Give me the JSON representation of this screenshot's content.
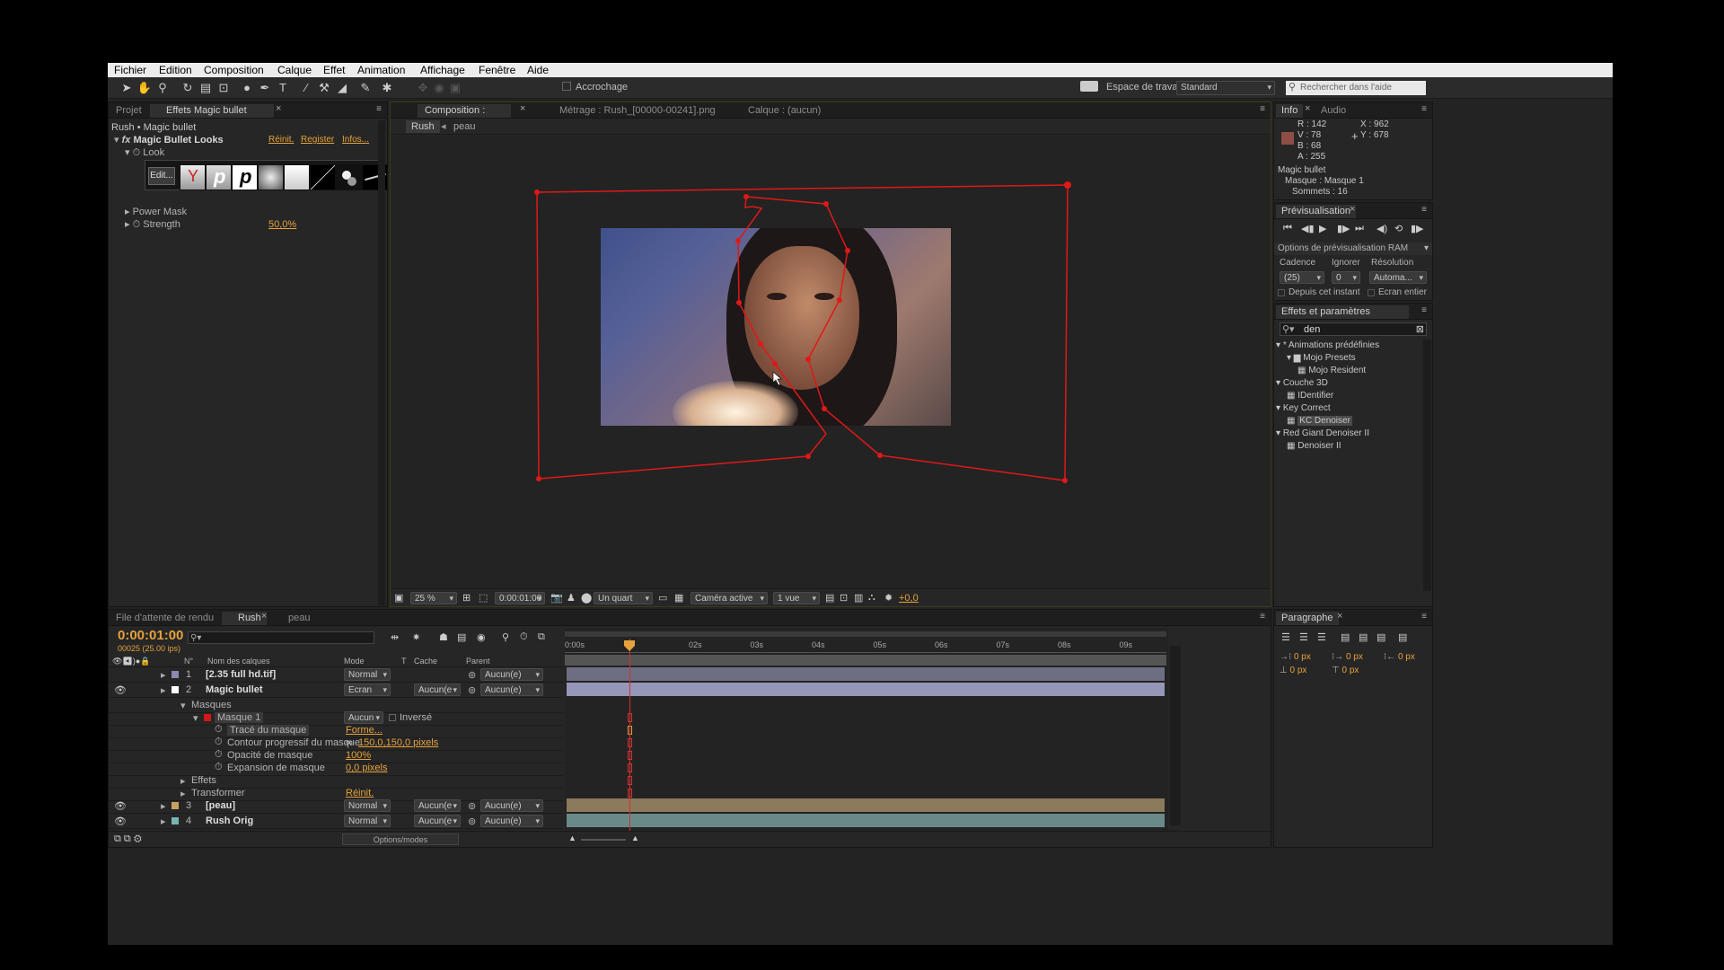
{
  "menu": [
    "Fichier",
    "Edition",
    "Composition",
    "Calque",
    "Effet",
    "Animation",
    "Affichage",
    "Fenêtre",
    "Aide"
  ],
  "toolbar": {
    "snapping": "Accrochage",
    "workspace_label": "Espace de travail :",
    "workspace_value": "Standard",
    "search_placeholder": "Rechercher dans l'aide"
  },
  "left_panel": {
    "tab_project": "Projet",
    "tab_effects": "Effets Magic bullet",
    "breadcrumb": "Rush • Magic bullet",
    "fx_name": "Magic Bullet Looks",
    "reset": "Réinit.",
    "register": "Register",
    "infos": "Infos...",
    "look_label": "Look",
    "edit_button": "Edit...",
    "power_mask": "Power Mask",
    "strength_label": "Strength",
    "strength_value": "50,0%"
  },
  "viewer": {
    "tab_comp": "Composition : Rush",
    "tab_footage": "Métrage : Rush_[00000-00241].png",
    "tab_layer": "Calque : (aucun)",
    "flow_rush": "Rush",
    "flow_peau": "peau",
    "zoom": "25 %",
    "timecode": "0:00:01:00",
    "resolution": "Un quart",
    "camera": "Caméra active",
    "views": "1 vue",
    "exposure": "+0,0"
  },
  "info_panel": {
    "tab_info": "Info",
    "tab_audio": "Audio",
    "r": "R : 142",
    "v": "V : 78",
    "b": "B : 68",
    "a": "A : 255",
    "x": "X : 962",
    "y": "Y : 678",
    "layer": "Magic bullet",
    "mask": "Masque : Masque 1",
    "vertices": "Sommets : 16",
    "swatch": "#8e4e44"
  },
  "preview_panel": {
    "tab": "Prévisualisation",
    "ram_options": "Options de prévisualisation RAM",
    "framerate_label": "Cadence",
    "skip_label": "Ignorer",
    "resolution_label": "Résolution",
    "framerate_value": "(25)",
    "skip_value": "0",
    "resolution_value": "Automa...",
    "from_current": "Depuis cet instant",
    "fullscreen": "Ecran entier"
  },
  "effects_panel": {
    "tab": "Effets et paramètres prédéfinis",
    "search_value": "den",
    "tree": [
      {
        "label": "* Animations prédéfinies",
        "level": 0,
        "type": "folder-open"
      },
      {
        "label": "Mojo Presets",
        "level": 1,
        "type": "folder"
      },
      {
        "label": "Mojo Resident",
        "level": 2,
        "type": "preset"
      },
      {
        "label": "Couche 3D",
        "level": 0,
        "type": "folder-open"
      },
      {
        "label": "IDentifier",
        "level": 1,
        "type": "effect"
      },
      {
        "label": "Key Correct",
        "level": 0,
        "type": "folder-open"
      },
      {
        "label": "KC Denoiser",
        "level": 1,
        "type": "effect",
        "selected": true
      },
      {
        "label": "Red Giant Denoiser II",
        "level": 0,
        "type": "folder-open"
      },
      {
        "label": "Denoiser II",
        "level": 1,
        "type": "effect"
      }
    ]
  },
  "timeline": {
    "tab_queue": "File d'attente de rendu",
    "tab_rush": "Rush",
    "tab_peau": "peau",
    "timecode": "0:00:01:00",
    "frames": "00025 (25.00 ips)",
    "col_num": "N°",
    "col_name": "Nom des calques",
    "col_mode": "Mode",
    "col_t": "T",
    "col_matte": "Cache",
    "col_parent": "Parent",
    "ruler": [
      "0:00s",
      "02s",
      "03s",
      "04s",
      "05s",
      "06s",
      "07s",
      "08s",
      "09s"
    ],
    "layers": [
      {
        "num": "1",
        "name": "[2.35 full hd.tif]",
        "mode": "Normal",
        "matte": "",
        "parent": "Aucun(e)",
        "color": "#8a8ab0"
      },
      {
        "num": "2",
        "name": "Magic bullet",
        "mode": "Ecran",
        "matte": "Aucun(e",
        "parent": "Aucun(e)",
        "color": "#ffffff"
      }
    ],
    "mask_rows": [
      {
        "label": "Masques",
        "value": ""
      },
      {
        "label": "Masque 1",
        "value": "Aucun",
        "extra": "Inversé"
      },
      {
        "label": "Tracé du masque",
        "value": "Forme..."
      },
      {
        "label": "Contour progressif du masque",
        "value": "150,0,150,0 pixels"
      },
      {
        "label": "Opacité de masque",
        "value": "100%"
      },
      {
        "label": "Expansion de masque",
        "value": "0,0 pixels"
      },
      {
        "label": "Effets",
        "value": ""
      },
      {
        "label": "Transformer",
        "value": "Réinit."
      }
    ],
    "layers2": [
      {
        "num": "3",
        "name": "[peau]",
        "mode": "Normal",
        "matte": "Aucun(e",
        "parent": "Aucun(e)",
        "color": "#c8a060"
      },
      {
        "num": "4",
        "name": "Rush Orig",
        "mode": "Normal",
        "matte": "Aucun(e",
        "parent": "Aucun(e)",
        "color": "#7ab4b4"
      }
    ],
    "options_modes": "Options/modes"
  },
  "paragraph_panel": {
    "tab": "Paragraphe",
    "v1": "0 px",
    "v2": "0 px",
    "v3": "0 px",
    "v4": "0 px",
    "v5": "0 px"
  }
}
